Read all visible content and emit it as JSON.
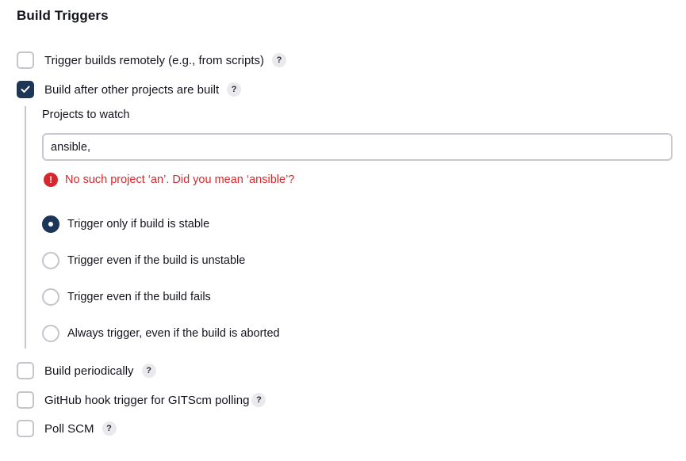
{
  "section": {
    "title": "Build Triggers"
  },
  "triggers": {
    "remote": {
      "label": "Trigger builds remotely (e.g., from scripts)",
      "checked": false,
      "help": "?"
    },
    "after_other": {
      "label": "Build after other projects are built",
      "checked": true,
      "help": "?"
    },
    "periodically": {
      "label": "Build periodically",
      "checked": false,
      "help": "?"
    },
    "github_hook": {
      "label": "GitHub hook trigger for GITScm polling",
      "checked": false,
      "help": "?"
    },
    "poll_scm": {
      "label": "Poll SCM",
      "checked": false,
      "help": "?"
    }
  },
  "projects_to_watch": {
    "label": "Projects to watch",
    "value": "ansible,",
    "error_icon": "!",
    "error": "No such project ‘an’. Did you mean ‘ansible’?"
  },
  "radio_options": [
    {
      "label": "Trigger only if build is stable",
      "selected": true
    },
    {
      "label": "Trigger even if the build is unstable",
      "selected": false
    },
    {
      "label": "Trigger even if the build fails",
      "selected": false
    },
    {
      "label": "Always trigger, even if the build is aborted",
      "selected": false
    }
  ],
  "colors": {
    "checked": "#1d3557",
    "error": "#d8262b",
    "border": "#c4c4cc"
  }
}
